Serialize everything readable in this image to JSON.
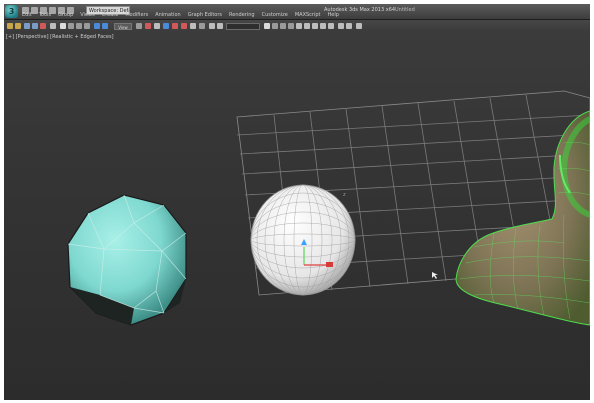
{
  "titlebar": {
    "app_icon_letter": "3",
    "workspace": "Workspace: Default",
    "title": "Autodesk 3ds Max 2013 x64",
    "file_name": "Untitled"
  },
  "menu": {
    "items": [
      "Edit",
      "Tools",
      "Group",
      "Views",
      "Create",
      "Modifiers",
      "Animation",
      "Graph Editors",
      "Rendering",
      "Customize",
      "MAXScript",
      "Help"
    ]
  },
  "toolbar": {
    "view_dropdown": "View"
  },
  "viewport": {
    "label": "[+] [Perspective] [Realistic + Edged Faces]",
    "background_top": "#3b3b3b",
    "background_bottom": "#2c2c2c",
    "objects": [
      {
        "name": "GeoSphere",
        "color": "#7ee0d6"
      },
      {
        "name": "Sphere",
        "color": "#ffffff"
      },
      {
        "name": "Head",
        "color": "#5fd85f"
      }
    ]
  }
}
